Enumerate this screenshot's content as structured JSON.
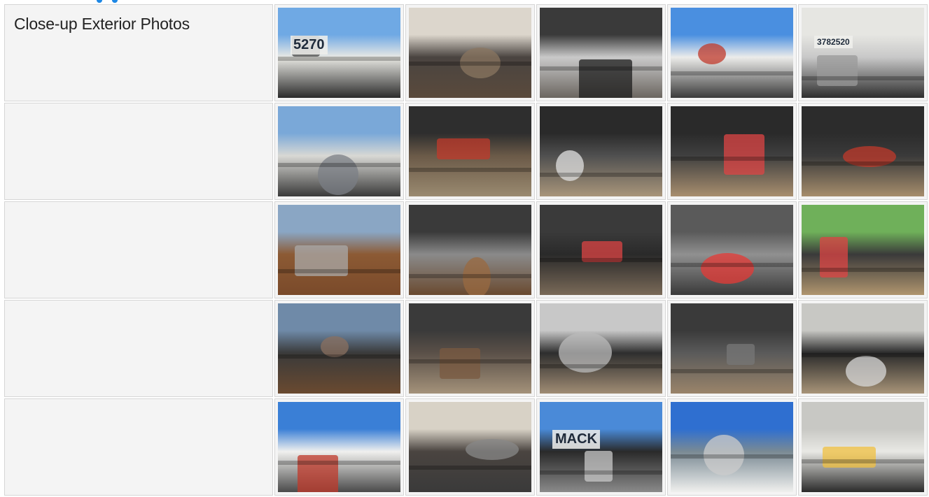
{
  "section": {
    "title": "Close-up Exterior Photos"
  },
  "photos": {
    "rows": [
      [
        {
          "alt": "cab door with unit number",
          "text": "5270",
          "top": "#6fa9e4",
          "mid": "#e9e9e4",
          "bot": "#2b2b2b",
          "accent": "#4a4a4a"
        },
        {
          "alt": "underbody hydraulics",
          "text": "",
          "top": "#dcd6cc",
          "mid": "#4a4440",
          "bot": "#5a4a3c",
          "accent": "#8a7560"
        },
        {
          "alt": "front wheel",
          "text": "",
          "top": "#3a3a3a",
          "mid": "#c9c9c9",
          "bot": "#6b6660",
          "accent": "#1e1e1e"
        },
        {
          "alt": "cab side with logo",
          "text": "",
          "top": "#4a8fe0",
          "mid": "#ececea",
          "bot": "#3a3a3a",
          "accent": "#c0392b"
        },
        {
          "alt": "fuel tank and step",
          "text": "3782520",
          "top": "#e6e6e2",
          "mid": "#c8c8c8",
          "bot": "#2e2e2e",
          "accent": "#9a9a9a"
        }
      ],
      [
        {
          "alt": "hydraulic lines behind cab",
          "text": "",
          "top": "#7aa8d8",
          "mid": "#d8d8d4",
          "bot": "#3a3a3a",
          "accent": "#7b7f86"
        },
        {
          "alt": "battery box",
          "text": "",
          "top": "#2e2e2e",
          "mid": "#6b5a48",
          "bot": "#9a8a70",
          "accent": "#c0392b"
        },
        {
          "alt": "hoist frame side",
          "text": "",
          "top": "#2a2a2a",
          "mid": "#505050",
          "bot": "#a8957a",
          "accent": "#e0e0e0"
        },
        {
          "alt": "tandem rear wheels",
          "text": "",
          "top": "#2a2a2a",
          "mid": "#404040",
          "bot": "#a88e6e",
          "accent": "#d44"
        },
        {
          "alt": "rear light and chains",
          "text": "",
          "top": "#2c2c2c",
          "mid": "#3a3a3a",
          "bot": "#a68d6c",
          "accent": "#c0392b"
        }
      ],
      [
        {
          "alt": "hoist rails view",
          "text": "",
          "top": "#8aa6c4",
          "mid": "#8c5a34",
          "bot": "#7a4a2a",
          "accent": "#aaa"
        },
        {
          "alt": "chains and mechanism",
          "text": "",
          "top": "#3a3a3a",
          "mid": "#8a8a8a",
          "bot": "#6a4a30",
          "accent": "#9a6a40"
        },
        {
          "alt": "rear tandem wheels close",
          "text": "",
          "top": "#3a3a3a",
          "mid": "#2a2a2a",
          "bot": "#7a6a58",
          "accent": "#d44"
        },
        {
          "alt": "hydraulic cylinder with light",
          "text": "",
          "top": "#5a5a5a",
          "mid": "#909090",
          "bot": "#3a3a3a",
          "accent": "#e53935"
        },
        {
          "alt": "rear frame and yard",
          "text": "",
          "top": "#6fb05a",
          "mid": "#3a3a3a",
          "bot": "#b0956e",
          "accent": "#d44"
        }
      ],
      [
        {
          "alt": "hoist rails rear",
          "text": "",
          "top": "#6f8aa8",
          "mid": "#3a3a3a",
          "bot": "#6a4a30",
          "accent": "#8a7060"
        },
        {
          "alt": "undercarriage",
          "text": "",
          "top": "#3a3a3a",
          "mid": "#5a5048",
          "bot": "#a4927a",
          "accent": "#7a5a40"
        },
        {
          "alt": "cab steps",
          "text": "",
          "top": "#c8c8c8",
          "mid": "#2e2e2e",
          "bot": "#a08c74",
          "accent": "#bbb"
        },
        {
          "alt": "frame and suspension",
          "text": "",
          "top": "#3a3a3a",
          "mid": "#5a5a5a",
          "bot": "#9a846a",
          "accent": "#777"
        },
        {
          "alt": "front tire close",
          "text": "",
          "top": "#c8c8c4",
          "mid": "#2a2a2a",
          "bot": "#a89478",
          "accent": "#d8d8d8"
        }
      ],
      [
        {
          "alt": "cab exterior",
          "text": "",
          "top": "#3a7fd6",
          "mid": "#f0f0ee",
          "bot": "#4a4a4a",
          "accent": "#c0392b"
        },
        {
          "alt": "underside front",
          "text": "",
          "top": "#d8d2c6",
          "mid": "#4a4440",
          "bot": "#3a3a3a",
          "accent": "#888"
        },
        {
          "alt": "front grille",
          "text": "MACK",
          "top": "#4a8ad8",
          "mid": "#2a2a2a",
          "bot": "#8a8a8a",
          "accent": "#c8c8c8"
        },
        {
          "alt": "cab roof and windshield",
          "text": "",
          "top": "#2f6fd0",
          "mid": "#7a8a94",
          "bot": "#f0f0ee",
          "accent": "#ccc"
        },
        {
          "alt": "headlight and tire",
          "text": "",
          "top": "#c8c8c4",
          "mid": "#e8e8e4",
          "bot": "#2a2a2a",
          "accent": "#f0c040"
        }
      ]
    ]
  }
}
